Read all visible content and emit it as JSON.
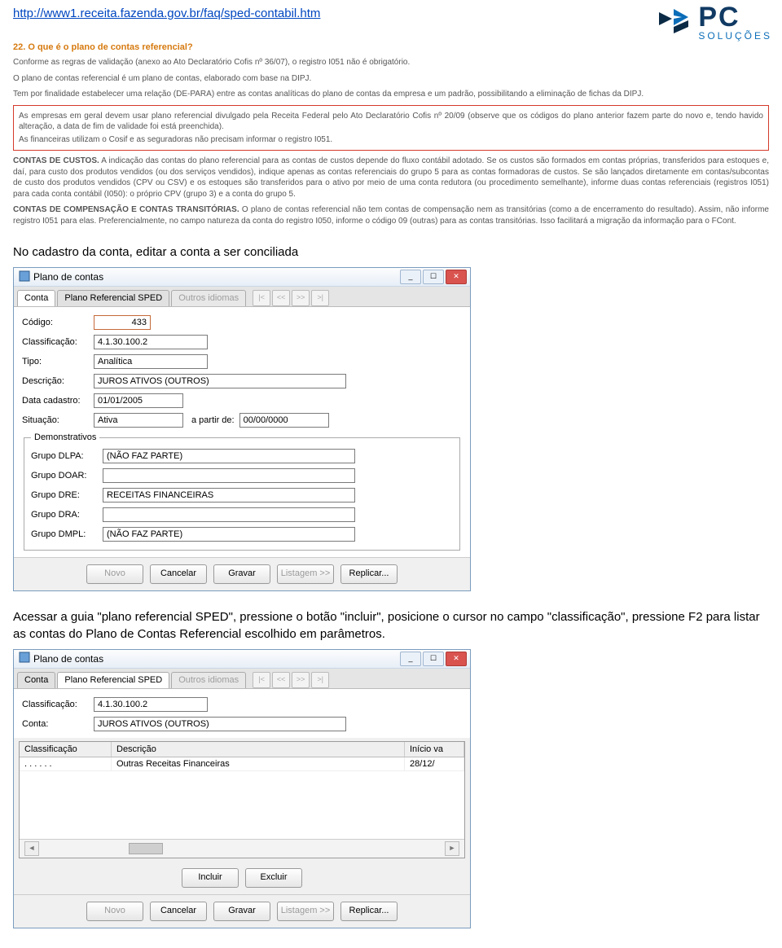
{
  "header_link": "http://www1.receita.fazenda.gov.br/faq/sped-contabil.htm",
  "logo": {
    "brand_pc": "PC",
    "brand_sol": "SOLUÇÕES"
  },
  "faq": {
    "q": "22. O que é o plano de contas referencial?",
    "p1": "Conforme as regras de validação (anexo ao Ato Declaratório Cofis nº 36/07), o registro I051 não é obrigatório.",
    "p2": "O plano de contas referencial é um plano de contas, elaborado com base na DIPJ.",
    "p3": "Tem por finalidade estabelecer uma relação (DE-PARA) entre as contas analíticas do plano de contas da empresa e um padrão, possibilitando a eliminação de fichas da DIPJ.",
    "box_p1": "As empresas em geral devem usar plano referencial divulgado pela Receita Federal pelo Ato Declaratório Cofis nº 20/09 (observe que os códigos do plano anterior fazem parte do novo e, tendo havido alteração, a data de fim de validade foi está preenchida).",
    "box_p2": "As financeiras utilizam o Cosif e as seguradoras não precisam informar o registro I051.",
    "p4_head": "CONTAS DE CUSTOS.",
    "p4": "A indicação das contas do plano referencial para as contas de custos depende do fluxo contábil adotado. Se os custos são formados em contas próprias, transferidos para estoques e, daí, para custo dos produtos vendidos (ou dos serviços vendidos), indique apenas as contas referenciais do grupo 5 para as contas formadoras de custos. Se são lançados diretamente em contas/subcontas de custo dos produtos vendidos (CPV ou CSV) e os estoques são transferidos para o ativo por meio de uma conta redutora (ou procedimento semelhante), informe duas contas referenciais (registros I051) para cada conta contábil (I050): o próprio CPV (grupo 3) e a conta do grupo 5.",
    "p5_head": "CONTAS DE COMPENSAÇÃO E CONTAS TRANSITÓRIAS.",
    "p5": "O plano de contas referencial não tem contas de compensação nem as transitórias (como a de encerramento do resultado). Assim, não informe registro I051 para elas. Preferencialmente, no campo natureza da conta do registro I050, informe o código 09 (outras) para as contas transitórias. Isso facilitará a migração da informação para o FCont."
  },
  "body": {
    "p1": "No cadastro da conta, editar a conta a ser conciliada",
    "p2": "Acessar a guia \"plano referencial SPED\", pressione o botão \"incluir\", posicione o cursor no campo \"classificação\", pressione F2 para listar as contas do Plano de Contas Referencial escolhido em parâmetros."
  },
  "win1": {
    "title": "Plano de contas",
    "tabs": {
      "t1": "Conta",
      "t2": "Plano Referencial SPED",
      "t3": "Outros idiomas"
    },
    "nav": {
      "first": "|<",
      "prev": "<<",
      "next": ">>",
      "last": ">|"
    },
    "labels": {
      "codigo": "Código:",
      "classif": "Classificação:",
      "tipo": "Tipo:",
      "descricao": "Descrição:",
      "datacad": "Data cadastro:",
      "situacao": "Situação:",
      "apartir": "a partir de:",
      "demons": "Demonstrativos",
      "gdlpa": "Grupo DLPA:",
      "gdoar": "Grupo DOAR:",
      "gdre": "Grupo DRE:",
      "gdra": "Grupo DRA:",
      "gdmpl": "Grupo DMPL:"
    },
    "values": {
      "codigo": "433",
      "classif": "4.1.30.100.2",
      "tipo": "Analítica",
      "descricao": "JUROS ATIVOS (OUTROS)",
      "datacad": "01/01/2005",
      "situacao": "Ativa",
      "apartir": "00/00/0000",
      "gdlpa": "(NÃO FAZ PARTE)",
      "gdoar": "",
      "gdre": "RECEITAS FINANCEIRAS",
      "gdra": "",
      "gdmpl": "(NÃO FAZ PARTE)"
    },
    "buttons": {
      "novo": "Novo",
      "cancelar": "Cancelar",
      "gravar": "Gravar",
      "listagem": "Listagem >>",
      "replicar": "Replicar..."
    }
  },
  "win2": {
    "title": "Plano de contas",
    "labels": {
      "classif": "Classificação:",
      "conta": "Conta:"
    },
    "values": {
      "classif": "4.1.30.100.2",
      "conta": "JUROS ATIVOS (OUTROS)"
    },
    "grid": {
      "cols": {
        "c1": "Classificação",
        "c2": "Descrição",
        "c3": "Início va"
      },
      "rows": [
        {
          "c1": ". . . . . .",
          "c2": "Outras Receitas Financeiras",
          "c3": "28/12/"
        }
      ]
    },
    "inc": {
      "incluir": "Incluir",
      "excluir": "Excluir"
    }
  }
}
